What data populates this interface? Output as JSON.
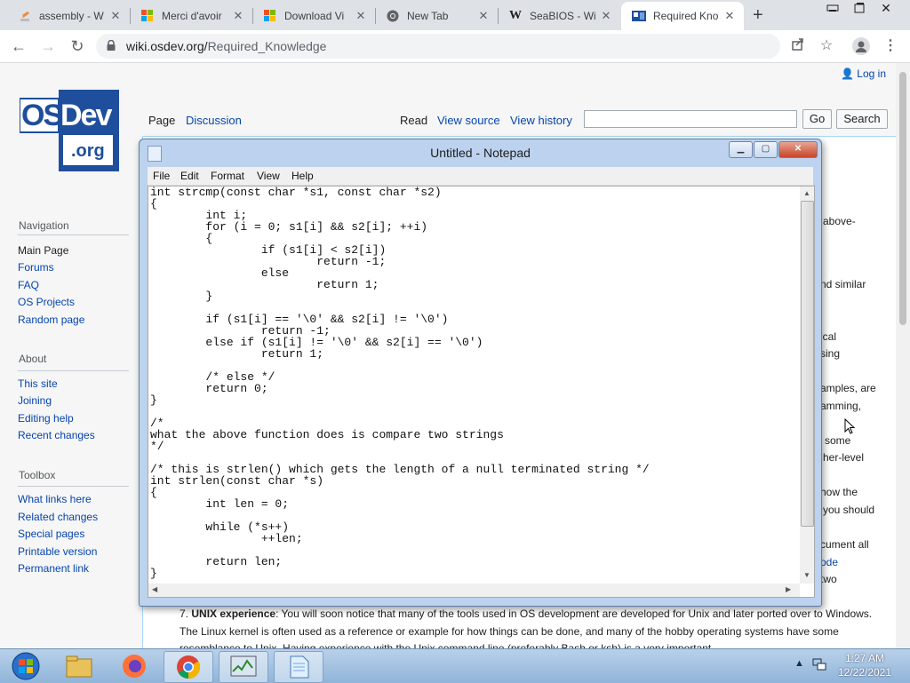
{
  "browser": {
    "tabs": [
      {
        "title": "assembly - W",
        "icon": "stackoverflow-icon"
      },
      {
        "title": "Merci d'avoir",
        "icon": "microsoft-icon"
      },
      {
        "title": "Download Vi",
        "icon": "microsoft-icon"
      },
      {
        "title": "New Tab",
        "icon": "chrome-icon"
      },
      {
        "title": "SeaBIOS - Wi",
        "icon": "wikipedia-icon"
      },
      {
        "title": "Required Kno",
        "icon": "osdev-icon"
      }
    ],
    "url_host": "wiki.osdev.org/",
    "url_path": "Required_Knowledge"
  },
  "wiki": {
    "login": "Log in",
    "logo_text": [
      "OS",
      "Dev",
      ".org"
    ],
    "tabs": {
      "page": "Page",
      "discussion": "Discussion",
      "read": "Read",
      "view_source": "View source",
      "view_history": "View history"
    },
    "go_label": "Go",
    "search_label": "Search",
    "sidebar": {
      "navigation_heading": "Navigation",
      "navigation": [
        "Main Page",
        "Forums",
        "FAQ",
        "OS Projects",
        "Random page"
      ],
      "about_heading": "About",
      "about": [
        "This site",
        "Joining",
        "Editing help",
        "Recent changes"
      ],
      "toolbox_heading": "Toolbox",
      "toolbox": [
        "What links here",
        "Related changes",
        "Special pages",
        "Printable version",
        "Permanent link"
      ]
    },
    "fragments": [
      "above-",
      "nd similar",
      "ical",
      "sing",
      "amples, are",
      "amming,",
      "some",
      "her-level",
      "how the",
      "you should",
      "cument all",
      "ode",
      "two"
    ],
    "item7_number": "7.",
    "item7_title": "UNIX experience",
    "item7_text": ": You will soon notice that many of the tools used in OS development are developed for Unix and later ported over to Windows. The Linux kernel is often used as a reference or example for how things can be done, and many of the hobby operating systems have some resemblance to Unix. Having experience with the Unix command line (preferably Bash or ksh) is a very important"
  },
  "notepad": {
    "title": "Untitled - Notepad",
    "menu": [
      "File",
      "Edit",
      "Format",
      "View",
      "Help"
    ],
    "code": "int strcmp(const char *s1, const char *s2)\n{\n        int i;\n        for (i = 0; s1[i] && s2[i]; ++i)\n        {\n                if (s1[i] < s2[i])\n                        return -1;\n                else\n                        return 1;\n        }\n\n        if (s1[i] == '\\0' && s2[i] != '\\0')\n                return -1;\n        else if (s1[i] != '\\0' && s2[i] == '\\0')\n                return 1;\n\n        /* else */\n        return 0;\n}\n\n/*\nwhat the above function does is compare two strings\n*/\n\n/* this is strlen() which gets the length of a null terminated string */\nint strlen(const char *s)\n{\n        int len = 0;\n\n        while (*s++)\n                ++len;\n\n        return len;\n}"
  },
  "taskbar": {
    "apps": [
      "start-orb-icon",
      "file-explorer-icon",
      "firefox-icon",
      "chrome-icon",
      "task-manager-icon",
      "notepad-icon"
    ],
    "time": "1:27 AM",
    "date": "12/22/2021"
  }
}
